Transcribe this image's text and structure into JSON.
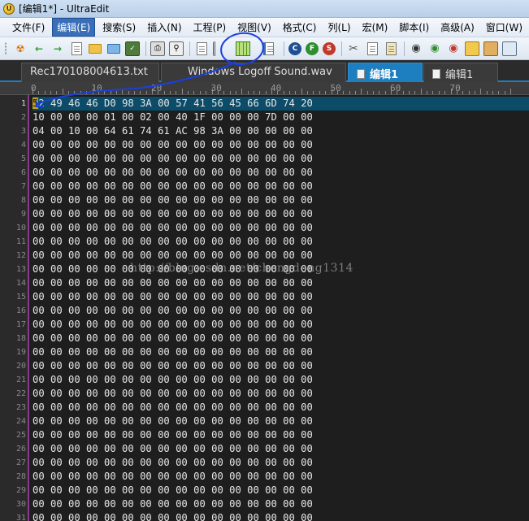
{
  "window": {
    "title": "[编辑1*] - UltraEdit"
  },
  "menu": [
    "文件(F)",
    "编辑(E)",
    "搜索(S)",
    "插入(N)",
    "工程(P)",
    "视图(V)",
    "格式(C)",
    "列(L)",
    "宏(M)",
    "脚本(I)",
    "高级(A)",
    "窗口(W)"
  ],
  "menu_active_index": 1,
  "tabs": [
    {
      "label": "Rec170108004613.txt",
      "active": false,
      "icon": false
    },
    {
      "label": "Windows Logoff Sound.wav",
      "active": false,
      "icon": false
    },
    {
      "label": "编辑1",
      "active": true,
      "icon": true
    },
    {
      "label": "编辑1",
      "active": false,
      "icon": true
    }
  ],
  "ruler_labels": [
    "0",
    "10",
    "20",
    "30",
    "40",
    "50",
    "60",
    "70"
  ],
  "hex_rows": [
    "52 49 46 46 D0 98 3A 00 57 41 56 45 66 6D 74 20",
    "10 00 00 00 01 00 02 00 40 1F 00 00 00 7D 00 00",
    "04 00 10 00 64 61 74 61 AC 98 3A 00 00 00 00 00",
    "00 00 00 00 00 00 00 00 00 00 00 00 00 00 00 00",
    "00 00 00 00 00 00 00 00 00 00 00 00 00 00 00 00",
    "00 00 00 00 00 00 00 00 00 00 00 00 00 00 00 00",
    "00 00 00 00 00 00 00 00 00 00 00 00 00 00 00 00",
    "00 00 00 00 00 00 00 00 00 00 00 00 00 00 00 00",
    "00 00 00 00 00 00 00 00 00 00 00 00 00 00 00 00",
    "00 00 00 00 00 00 00 00 00 00 00 00 00 00 00 00",
    "00 00 00 00 00 00 00 00 00 00 00 00 00 00 00 00",
    "00 00 00 00 00 00 00 00 00 00 00 00 00 00 00 00",
    "00 00 00 00 00 00 00 00 00 00 00 00 00 00 00 00",
    "00 00 00 00 00 00 00 00 00 00 00 00 00 00 00 00",
    "00 00 00 00 00 00 00 00 00 00 00 00 00 00 00 00",
    "00 00 00 00 00 00 00 00 00 00 00 00 00 00 00 00",
    "00 00 00 00 00 00 00 00 00 00 00 00 00 00 00 00",
    "00 00 00 00 00 00 00 00 00 00 00 00 00 00 00 00",
    "00 00 00 00 00 00 00 00 00 00 00 00 00 00 00 00",
    "00 00 00 00 00 00 00 00 00 00 00 00 00 00 00 00",
    "00 00 00 00 00 00 00 00 00 00 00 00 00 00 00 00",
    "00 00 00 00 00 00 00 00 00 00 00 00 00 00 00 00",
    "00 00 00 00 00 00 00 00 00 00 00 00 00 00 00 00",
    "00 00 00 00 00 00 00 00 00 00 00 00 00 00 00 00",
    "00 00 00 00 00 00 00 00 00 00 00 00 00 00 00 00",
    "00 00 00 00 00 00 00 00 00 00 00 00 00 00 00 00",
    "00 00 00 00 00 00 00 00 00 00 00 00 00 00 00 00",
    "00 00 00 00 00 00 00 00 00 00 00 00 00 00 00 00",
    "00 00 00 00 00 00 00 00 00 00 00 00 00 00 00 00",
    "00 00 00 00 00 00 00 00 00 00 00 00 00 00 00 00",
    "00 00 00 00 00 00 00 00 00 00 00 00 00 00 00 00"
  ],
  "current_line": 1,
  "watermark": "http://blog.csdn.net/chengdong1314",
  "colors": {
    "accent": "#1e7fc0",
    "annotation": "#1a3fe0",
    "current_line_bg": "#0c4c68"
  }
}
